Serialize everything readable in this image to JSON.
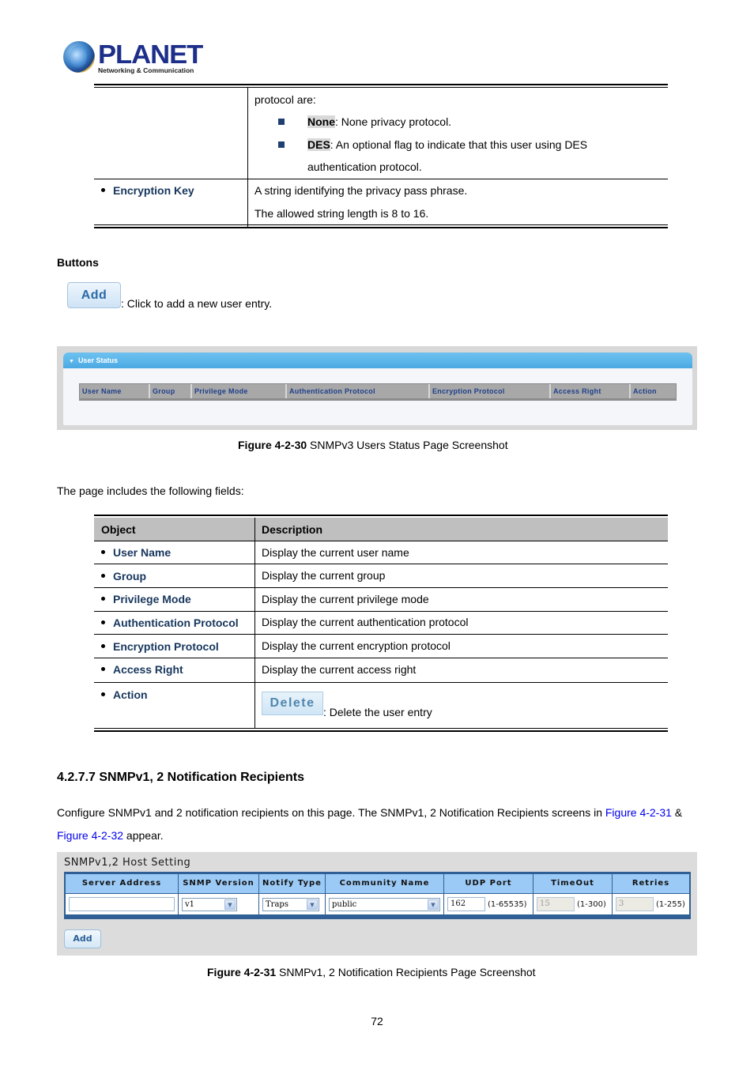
{
  "logo": {
    "brand": "PLANET",
    "tagline": "Networking & Communication"
  },
  "upper_table": {
    "intro": "protocol are:",
    "options": [
      {
        "term": "None",
        "text": ": None privacy protocol."
      },
      {
        "term": "DES",
        "text": ": An optional flag to indicate that this user using DES",
        "continuation": "authentication protocol."
      }
    ],
    "rows": [
      {
        "object": "Encryption Key",
        "lines": [
          "A string identifying the privacy pass phrase.",
          "The allowed string length is 8 to 16."
        ]
      }
    ]
  },
  "buttons_section": {
    "heading": "Buttons",
    "add_button_label": "Add",
    "add_description": ": Click to add a new user entry."
  },
  "user_status_screenshot": {
    "panel_title": "User Status",
    "columns": [
      "User Name",
      "Group",
      "Privilege Mode",
      "Authentication Protocol",
      "Encryption Protocol",
      "Access Right",
      "Action"
    ]
  },
  "figure_30": {
    "number": "Figure 4-2-30",
    "caption": " SNMPv3 Users Status Page Screenshot"
  },
  "fields_intro": "The page includes the following fields:",
  "fields_table": {
    "headers": {
      "object": "Object",
      "description": "Description"
    },
    "rows": [
      {
        "object": "User Name",
        "description": "Display the current user name"
      },
      {
        "object": "Group",
        "description": "Display the current group"
      },
      {
        "object": "Privilege Mode",
        "description": "Display the current privilege mode"
      },
      {
        "object": "Authentication Protocol",
        "description": "Display the current authentication protocol"
      },
      {
        "object": "Encryption Protocol",
        "description": "Display the current encryption protocol"
      },
      {
        "object": "Access Right",
        "description": "Display the current access right"
      },
      {
        "object": "Action",
        "button_label": "Delete",
        "description": ": Delete the user entry"
      }
    ]
  },
  "section": {
    "title": "4.2.7.7 SNMPv1, 2 Notification Recipients",
    "para_line1_prefix": "Configure SNMPv1 and 2 notification recipients on this page. The SNMPv1, 2 Notification Recipients screens in ",
    "link1": "Figure 4-2-31",
    "para_line1_suffix": " &",
    "link2": "Figure 4-2-32",
    "para_line2_suffix": " appear."
  },
  "host_setting_screenshot": {
    "title": "SNMPv1,2 Host Setting",
    "columns": [
      "Server Address",
      "SNMP Version",
      "Notify Type",
      "Community Name",
      "UDP Port",
      "TimeOut",
      "Retries"
    ],
    "row": {
      "server_address": "",
      "snmp_version": "v1",
      "notify_type": "Traps",
      "community_name": "public",
      "udp_port": "162",
      "udp_port_range": "(1-65535)",
      "timeout": "15",
      "timeout_range": "(1-300)",
      "retries": "3",
      "retries_range": "(1-255)"
    },
    "add_label": "Add"
  },
  "figure_31": {
    "number": "Figure 4-2-31",
    "caption": " SNMPv1, 2 Notification Recipients Page Screenshot"
  },
  "page_number": "72",
  "colors": {
    "object_label": "#17365d",
    "link": "#0000ee",
    "panel_header": "#5bb6ea",
    "host_table_border": "#2f5f94",
    "host_table_header": "#9ccaf6"
  }
}
